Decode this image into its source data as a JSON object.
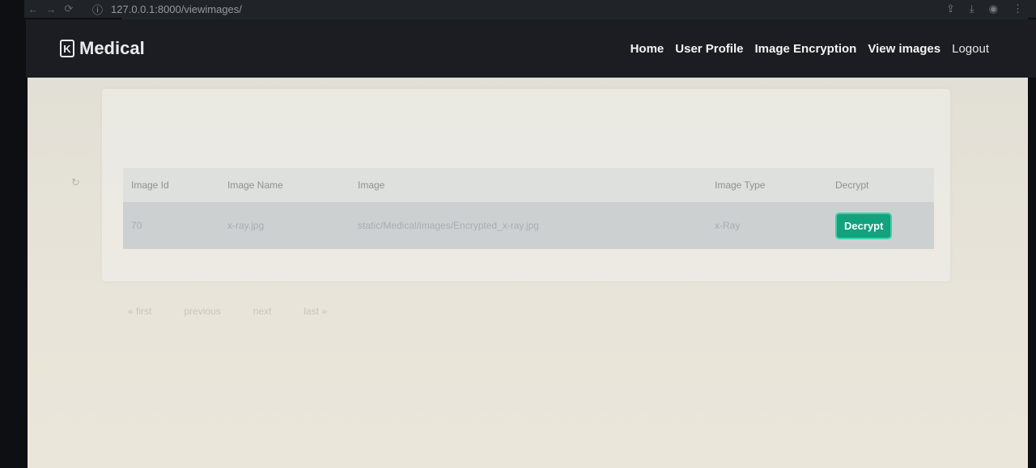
{
  "browser": {
    "back_glyph": "←",
    "forward_glyph": "→",
    "reload_glyph": "⟳",
    "site_info_glyph": "ⓘ",
    "url": "127.0.0.1:8000/viewimages/",
    "share_glyph": "⇪",
    "download_glyph": "⤓",
    "profile_glyph": "◉",
    "menu_glyph": "⋮"
  },
  "brand": {
    "logo_glyph": "K",
    "name": "Medical"
  },
  "nav": {
    "home": "Home",
    "user_profile": "User Profile",
    "image_encryption": "Image Encryption",
    "view_images": "View images",
    "logout": "Logout"
  },
  "side_mark": "↻",
  "table": {
    "headers": [
      "Image Id",
      "Image Name",
      "Image",
      "Image Type",
      "Decrypt"
    ],
    "rows": [
      {
        "id": "70",
        "name": "x-ray.jpg",
        "image": "static/Medical/images/Encrypted_x-ray.jpg",
        "type": "x-Ray",
        "action": "Decrypt"
      }
    ]
  },
  "pagination": [
    "« first",
    "previous",
    "next",
    "last »"
  ],
  "colors": {
    "nav_bg": "#1b1d22",
    "page_bg": "#e2dfd6",
    "accent": "#14a17d"
  }
}
